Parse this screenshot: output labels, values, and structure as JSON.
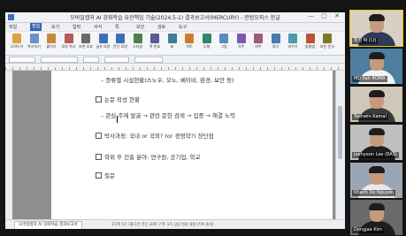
{
  "window": {
    "title": "모바일캡처 AI 강화학습 유관책임 기술(2024.5-1) 결과보고서(MERCURY) - 한컴오피스 한글",
    "controls": "— ▢ ✕"
  },
  "menu": {
    "items": [
      "파일",
      "편집",
      "보기",
      "입력",
      "서식",
      "쪽",
      "보안",
      "검토",
      "도구"
    ],
    "active_index": 1
  },
  "ribbon": {
    "buttons": [
      {
        "label": "오려두기",
        "icon": "cut-icon",
        "color": "#d9a441"
      },
      {
        "label": "복사하기",
        "icon": "copy-icon",
        "color": "#6c8fc9"
      },
      {
        "label": "붙이기",
        "icon": "paste-icon",
        "color": "#c58a3c"
      },
      {
        "label": "모양 복사",
        "icon": "format-painter-icon",
        "color": "#b45a5a"
      },
      {
        "label": "조판 부호",
        "icon": "markup-icon",
        "color": "#6a6a6a"
      },
      {
        "label": "글자 모양",
        "icon": "char-shape-icon",
        "color": "#3a6fc0"
      },
      {
        "label": "문단 모양",
        "icon": "para-shape-icon",
        "color": "#3a6fc0"
      },
      {
        "label": "스타일",
        "icon": "style-icon",
        "color": "#4f7f4f"
      },
      {
        "label": "쪽 번호",
        "icon": "page-number-icon",
        "color": "#5a5a9a"
      },
      {
        "label": "표",
        "icon": "table-icon",
        "color": "#3b7f9a"
      },
      {
        "label": "차트",
        "icon": "chart-icon",
        "color": "#d07a2f"
      },
      {
        "label": "도형",
        "icon": "shape-icon",
        "color": "#2f8a6a"
      },
      {
        "label": "그림",
        "icon": "image-icon",
        "color": "#5a8ac0"
      },
      {
        "label": "각주",
        "icon": "footnote-icon",
        "color": "#7a5ab0"
      },
      {
        "label": "미주",
        "icon": "endnote-icon",
        "color": "#a05a7a"
      },
      {
        "label": "찾기",
        "icon": "find-icon",
        "color": "#4a7ab0"
      },
      {
        "label": "바꾸기",
        "icon": "replace-icon",
        "color": "#4a9ab0"
      },
      {
        "label": "맞춤법",
        "icon": "spellcheck-icon",
        "color": "#c0503a"
      },
      {
        "label": "보안 문서",
        "icon": "security-icon",
        "color": "#7a7a2a"
      }
    ]
  },
  "document": {
    "lines": [
      {
        "text": "– 종류별 시설현황(스노우, 모노, 베이비, 환경, 보안 등)",
        "check": false
      },
      {
        "text": "논문 작성 현황",
        "check": true
      },
      {
        "text": "– 관심 주제 발굴 → 관련 문헌 검색 → 집중 → 해결 노력",
        "check": false
      },
      {
        "text": "박사과정: 국내 or 국외? (or 경영학?) 장단점",
        "check": true
      },
      {
        "text": "학위 후 진출 분야: 연구원, 공기업, 학교",
        "check": true
      },
      {
        "text": "질문",
        "check": true
      }
    ],
    "tab_label": "모바일캡처 AI 강화학습 결과보고서",
    "status": "1/1쪽  1단  1줄  1칸  문단 3/40  구역: 1/1  삽입  변경 내용 [기록 중지]"
  },
  "participants": [
    {
      "name": "최성 탁 (나)",
      "active": true,
      "shirt": "#2d3b55",
      "bg": "#d8d0c4"
    },
    {
      "name": "MD Ilah ROMA",
      "active": false,
      "shirt": "#f2f2f2",
      "bg": "#4e7fa0"
    },
    {
      "name": "Tashwin Kamal",
      "active": false,
      "shirt": "#3a3a3a",
      "bg": "#cfc7b8"
    },
    {
      "name": "Jaehyeon Lee (RAS)",
      "active": false,
      "shirt": "#1f1f1f",
      "bg": "#bfbfbf"
    },
    {
      "name": "Khanh Do Nguyen",
      "active": false,
      "shirt": "#e8e8e8",
      "bg": "#9aa7b3"
    },
    {
      "name": "Dongjae Kim",
      "active": false,
      "shirt": "#1e1e1e",
      "bg": "#6a6a6a"
    }
  ]
}
